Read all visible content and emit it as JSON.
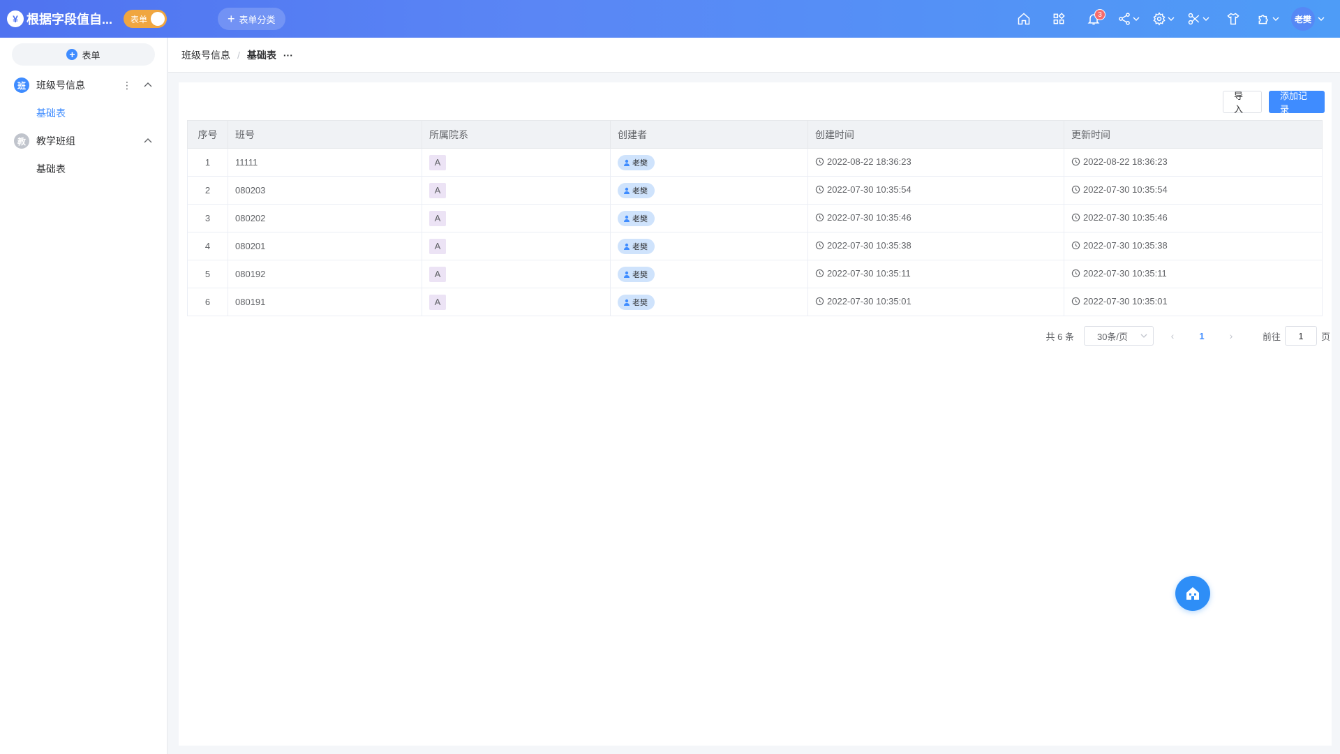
{
  "app": {
    "logo_glyph": "¥",
    "title": "根据字段值自...",
    "mode_label": "表单",
    "category_button": "表单分类"
  },
  "top_icons": [
    {
      "name": "home-icon"
    },
    {
      "name": "apps-icon"
    },
    {
      "name": "bell-icon",
      "badge": "3"
    },
    {
      "name": "share-icon"
    },
    {
      "name": "gear-icon"
    },
    {
      "name": "tools-icon"
    },
    {
      "name": "shirt-icon"
    },
    {
      "name": "puzzle-icon"
    }
  ],
  "user": {
    "name": "老樊"
  },
  "sidebar": {
    "add_form_label": "表单",
    "groups": [
      {
        "icon_text": "班",
        "label": "班级号信息",
        "items": [
          {
            "label": "基础表",
            "active": true
          }
        ]
      },
      {
        "icon_text": "教",
        "label": "教学班组",
        "items": [
          {
            "label": "基础表",
            "active": false
          }
        ]
      }
    ]
  },
  "breadcrumb": {
    "parent": "班级号信息",
    "separator": "/",
    "current": "基础表",
    "more": "···"
  },
  "toolbar": {
    "import_label": "导入",
    "add_label": "添加记录"
  },
  "table": {
    "columns": [
      "序号",
      "班号",
      "所属院系",
      "创建者",
      "创建时间",
      "更新时间"
    ],
    "rows": [
      {
        "index": "1",
        "class_no": "11111",
        "dept": "A",
        "creator": "老樊",
        "created": "2022-08-22 18:36:23",
        "updated": "2022-08-22 18:36:23"
      },
      {
        "index": "2",
        "class_no": "080203",
        "dept": "A",
        "creator": "老樊",
        "created": "2022-07-30 10:35:54",
        "updated": "2022-07-30 10:35:54"
      },
      {
        "index": "3",
        "class_no": "080202",
        "dept": "A",
        "creator": "老樊",
        "created": "2022-07-30 10:35:46",
        "updated": "2022-07-30 10:35:46"
      },
      {
        "index": "4",
        "class_no": "080201",
        "dept": "A",
        "creator": "老樊",
        "created": "2022-07-30 10:35:38",
        "updated": "2022-07-30 10:35:38"
      },
      {
        "index": "5",
        "class_no": "080192",
        "dept": "A",
        "creator": "老樊",
        "created": "2022-07-30 10:35:11",
        "updated": "2022-07-30 10:35:11"
      },
      {
        "index": "6",
        "class_no": "080191",
        "dept": "A",
        "creator": "老樊",
        "created": "2022-07-30 10:35:01",
        "updated": "2022-07-30 10:35:01"
      }
    ]
  },
  "pagination": {
    "total_text": "共 6 条",
    "page_size": "30条/页",
    "current_page": "1",
    "goto_prefix": "前往",
    "goto_value": "1",
    "goto_suffix": "页"
  },
  "colors": {
    "accent": "#3f8cff",
    "topbar_start": "#4f73f0",
    "topbar_end": "#4e9cf7",
    "toggle": "#f0a640",
    "badge": "#f56c6c"
  }
}
